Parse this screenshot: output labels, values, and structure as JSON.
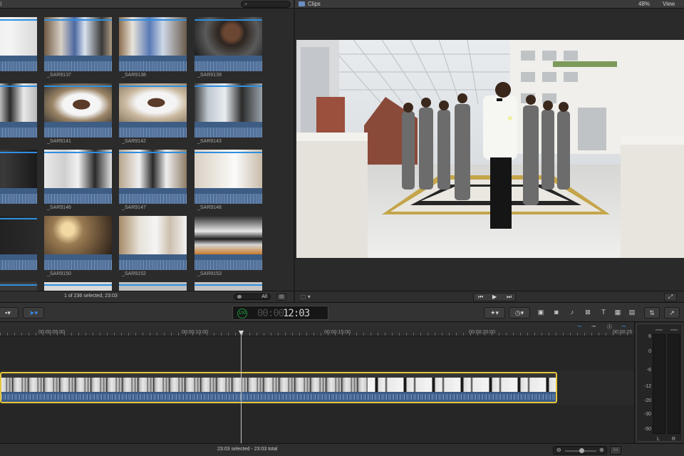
{
  "browser": {
    "header_left": "d",
    "search": {
      "placeholder": "",
      "icon": "search-icon"
    },
    "clips": [
      {
        "label": ""
      },
      {
        "label": "_SAR9137"
      },
      {
        "label": "_SAR9138"
      },
      {
        "label": "_SAR9139"
      },
      {
        "label": ""
      },
      {
        "label": "_SAR9141"
      },
      {
        "label": "_SAR9142"
      },
      {
        "label": "_SAR9143"
      },
      {
        "label": ""
      },
      {
        "label": "_SAR9146"
      },
      {
        "label": "_SAR9147"
      },
      {
        "label": "_SAR9148"
      },
      {
        "label": ""
      },
      {
        "label": "_SAR9150"
      },
      {
        "label": "_SAR9152"
      },
      {
        "label": "_SAR9153"
      },
      {
        "label": ""
      },
      {
        "label": ""
      },
      {
        "label": ""
      },
      {
        "label": ""
      }
    ],
    "status": "1 of 236 selected, 23:03",
    "duration_label": "All"
  },
  "viewer": {
    "title": "Clips",
    "zoom": "48%",
    "view_menu": "View"
  },
  "toolbar": {
    "timecode_dim": "00:00:",
    "timecode": "12:03",
    "timecode_badge": "100"
  },
  "timeline": {
    "ruler_labels": [
      "00:00:05:00",
      "00:00:10:00",
      "00:00:15:00",
      "00:00:20:00",
      "00:00:25"
    ]
  },
  "meters": {
    "scale": [
      "6",
      "0",
      "-6",
      "-12",
      "-20",
      "-30",
      "-50"
    ],
    "channels": [
      "L",
      "R"
    ]
  },
  "statusbar": {
    "text": "23:03 selected - 23:03 total"
  },
  "colors": {
    "selection_yellow": "#e5c53d",
    "audio_blue": "#3e5d85",
    "blue_line": "#2f8fe0",
    "timecode_green": "#1fb34a"
  }
}
